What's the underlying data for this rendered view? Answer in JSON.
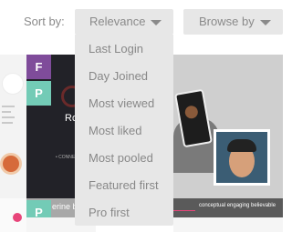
{
  "sort": {
    "label": "Sort by:",
    "selected": "Relevance",
    "options": [
      "Last Login",
      "Day Joined",
      "Most viewed",
      "Most liked",
      "Most pooled",
      "Featured first",
      "Pro first"
    ]
  },
  "browse": {
    "label": "Browse by"
  },
  "cards": [
    {
      "badges": [
        "F",
        "P",
        "P"
      ],
      "partial_text": "Ro",
      "footer_text": "erine b",
      "connect_text": "• CONNE"
    },
    {
      "footer_text": "conceptual engaging believable"
    }
  ],
  "colors": {
    "dropdown_bg": "#e7e7e7",
    "text_gray": "#8a8a8a",
    "badge_purple": "#7f4c9a",
    "badge_teal": "#73cbb6"
  }
}
